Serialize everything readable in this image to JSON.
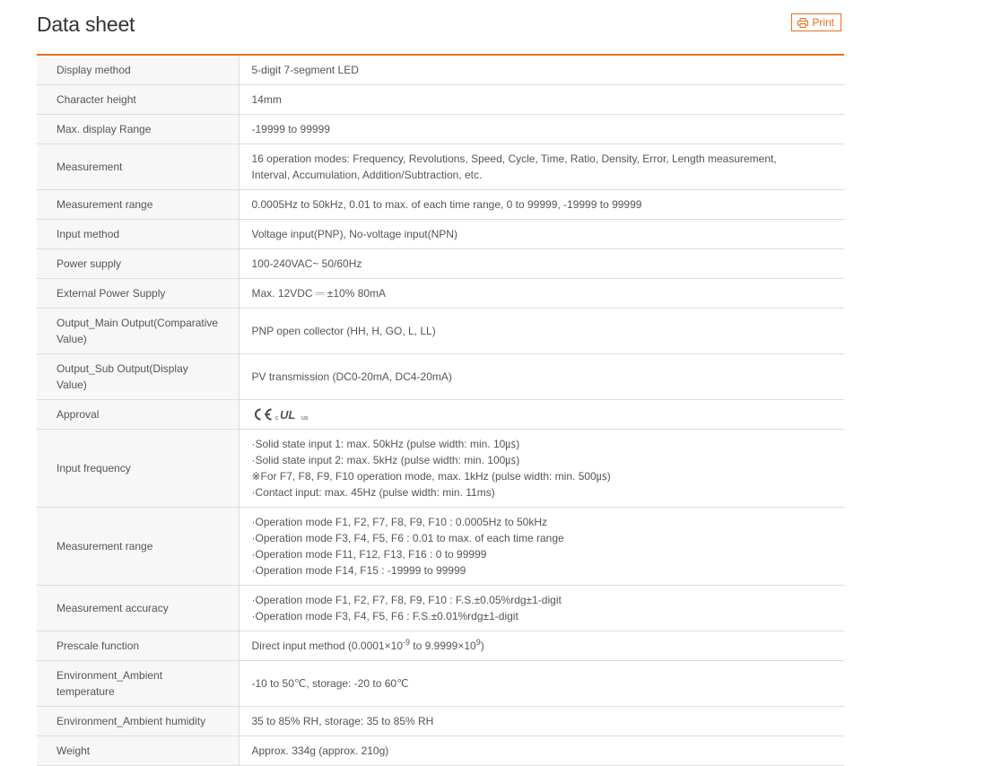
{
  "header": {
    "title": "Data sheet",
    "print_label": "Print"
  },
  "rows": [
    {
      "label": "Display method",
      "value": "5-digit 7-segment LED"
    },
    {
      "label": "Character height",
      "value": "14mm"
    },
    {
      "label": "Max. display Range",
      "value": "-19999 to 99999"
    },
    {
      "label": "Measurement",
      "lines": [
        "16 operation modes: Frequency, Revolutions, Speed, Cycle, Time, Ratio, Density, Error, Length measurement,",
        "Interval, Accumulation, Addition/Subtraction, etc."
      ]
    },
    {
      "label": "Measurement range",
      "value": "0.0005Hz to 50kHz, 0.01 to max. of each time range, 0 to 99999, -19999 to 99999"
    },
    {
      "label": "Input method",
      "value": "Voltage input(PNP), No-voltage input(NPN)"
    },
    {
      "label": "Power supply",
      "value": "100-240VAC~ 50/60Hz"
    },
    {
      "label": "External Power Supply",
      "value": "Max. 12VDC ⎓ ±10% 80mA"
    },
    {
      "label": "Output_Main Output(Comparative Value)",
      "value": "PNP open collector (HH, H, GO, L, LL)"
    },
    {
      "label": "Output_Sub Output(Display Value)",
      "value": "PV transmission (DC0-20mA, DC4-20mA)"
    },
    {
      "label": "Approval",
      "approval_marks": [
        "CE",
        "c",
        "UL",
        "us"
      ]
    },
    {
      "label": "Input frequency",
      "lines": [
        "·Solid state input 1: max. 50kHz (pulse width: min. 10㎲)",
        "·Solid state input 2: max. 5kHz (pulse width: min. 100㎲)",
        "※For F7, F8, F9, F10 operation mode, max. 1kHz (pulse width: min. 500㎲)",
        "·Contact input: max. 45Hz (pulse width: min. 11ms)"
      ]
    },
    {
      "label": "Measurement range",
      "lines": [
        "·Operation mode F1, F2, F7, F8, F9, F10 : 0.0005Hz to 50kHz",
        "·Operation mode F3, F4, F5, F6 : 0.01 to max. of each time range",
        "·Operation mode F11, F12, F13, F16 : 0 to 99999",
        "·Operation mode F14, F15 : -19999 to 99999"
      ]
    },
    {
      "label": "Measurement accuracy",
      "lines": [
        "·Operation mode F1, F2, F7, F8, F9, F10 : F.S.±0.05%rdg±1-digit",
        "·Operation mode F3, F4, F5, F6 : F.S.±0.01%rdg±1-digit"
      ]
    },
    {
      "label": "Prescale function",
      "prescale": {
        "before": "Direct input method (0.0001×10",
        "exp1": "-9",
        "middle": " to 9.9999×10",
        "exp2": "9",
        "after": ")"
      }
    },
    {
      "label": "Environment_Ambient temperature",
      "value": "-10 to 50℃, storage: -20 to 60℃"
    },
    {
      "label": "Environment_Ambient humidity",
      "value": "35 to 85% RH, storage: 35 to 85% RH"
    },
    {
      "label": "Weight",
      "value": "Approx. 334g (approx. 210g)"
    }
  ],
  "colors": {
    "accent": "#e3711f",
    "border": "#dddddd",
    "label_bg": "#f7f7f7",
    "text": "#555555"
  },
  "icons": {
    "print": "printer-icon"
  }
}
